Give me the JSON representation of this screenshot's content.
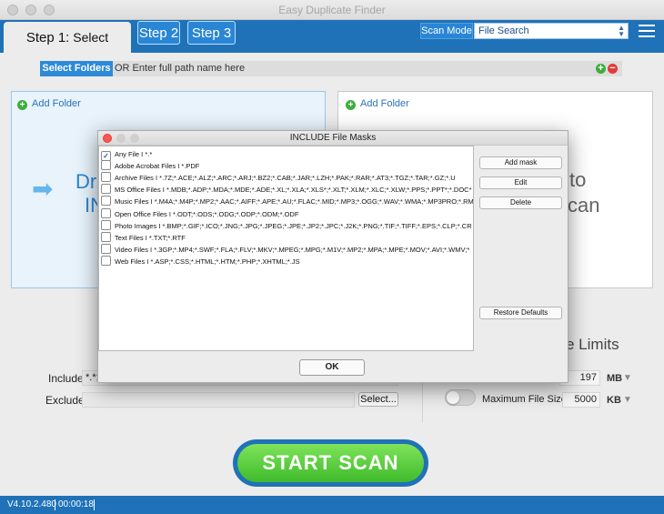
{
  "window": {
    "title": "Easy Duplicate Finder"
  },
  "header": {
    "step1_num": "Step 1:",
    "step1_text": "Select Folders",
    "step2": "Step 2",
    "step3": "Step 3",
    "scan_mode_label": "Scan Mode",
    "scan_mode_value": "File Search"
  },
  "path_bar": {
    "button": "Select Folders",
    "placeholder": "OR Enter full path name here"
  },
  "left_panel": {
    "add_folder": "Add Folder",
    "big_line1": "Dr",
    "big_line2": "IN"
  },
  "right_panel": {
    "add_folder": "Add Folder",
    "big_line1": "to",
    "big_line2": "can"
  },
  "filters": {
    "include_label": "Include:",
    "include_value": "*.*;",
    "exclude_label": "Exclude:",
    "exclude_value": "",
    "select_button": "Select..."
  },
  "limits": {
    "title_fragment": "e Limits",
    "min_value": "197",
    "min_unit": "MB",
    "max_label": "Maximum File Size",
    "max_value": "5000",
    "max_unit": "KB"
  },
  "start_scan": "START SCAN",
  "status": {
    "version": "V4.10.2.480",
    "time": "00:00:18"
  },
  "modal": {
    "title": "INCLUDE File Masks",
    "items": [
      {
        "label": "Any File I *.*",
        "checked": true
      },
      {
        "label": "Adobe Acrobat Files I *.PDF",
        "checked": false
      },
      {
        "label": "Archive Files I *.7Z;*.ACE;*.ALZ;*.ARC;*.ARJ;*.BZ2;*.CAB;*.JAR;*.LZH;*.PAK;*.RAR;*.AT3;*.TGZ;*.TAR;*.GZ;*.U",
        "checked": false
      },
      {
        "label": "MS Office Files I *.MDB;*.ADP;*.MDA;*.MDE;*.ADE;*.XL;*.XLA;*.XLS*;*.XLT;*.XLM;*.XLC;*.XLW;*.PPS;*.PPT*;*.DOC*",
        "checked": false
      },
      {
        "label": "Music Files I *.M4A;*.M4P;*.MP2;*.AAC;*.AIFF;*.APE;*.AU;*.FLAC;*.MID;*.MP3;*.OGG;*.WAV;*.WMA;*.MP3PRO;*.RM",
        "checked": false
      },
      {
        "label": "Open Office Files I *.ODT;*.ODS;*.ODG;*.ODP;*.ODM;*.ODF",
        "checked": false
      },
      {
        "label": "Photo Images I *.BMP;*.GIF;*.ICO;*.JNG;*.JPG;*.JPEG;*.JPE;*.JP2;*.JPC;*.J2K;*.PNG;*.TIF;*.TIFF;*.EPS;*.CLP;*.CR",
        "checked": false
      },
      {
        "label": "Text Files I *.TXT;*.RTF",
        "checked": false
      },
      {
        "label": "Video Files I *.3GP;*.MP4;*.SWF;*.FLA;*.FLV;*.MKV;*.MPEG;*.MPG;*.M1V;*.MP2;*.MPA;*.MPE;*.MOV;*.AVI;*.WMV;*",
        "checked": false
      },
      {
        "label": "Web Files I *.ASP;*.CSS;*.HTML;*.HTM;*.PHP;*.XHTML;*.JS",
        "checked": false
      }
    ],
    "add_mask": "Add mask",
    "edit": "Edit",
    "delete": "Delete",
    "restore_defaults": "Restore Defaults",
    "ok": "OK"
  },
  "colors": {
    "brand_blue": "#1f72b8",
    "start_green": "#3fbb2c"
  }
}
